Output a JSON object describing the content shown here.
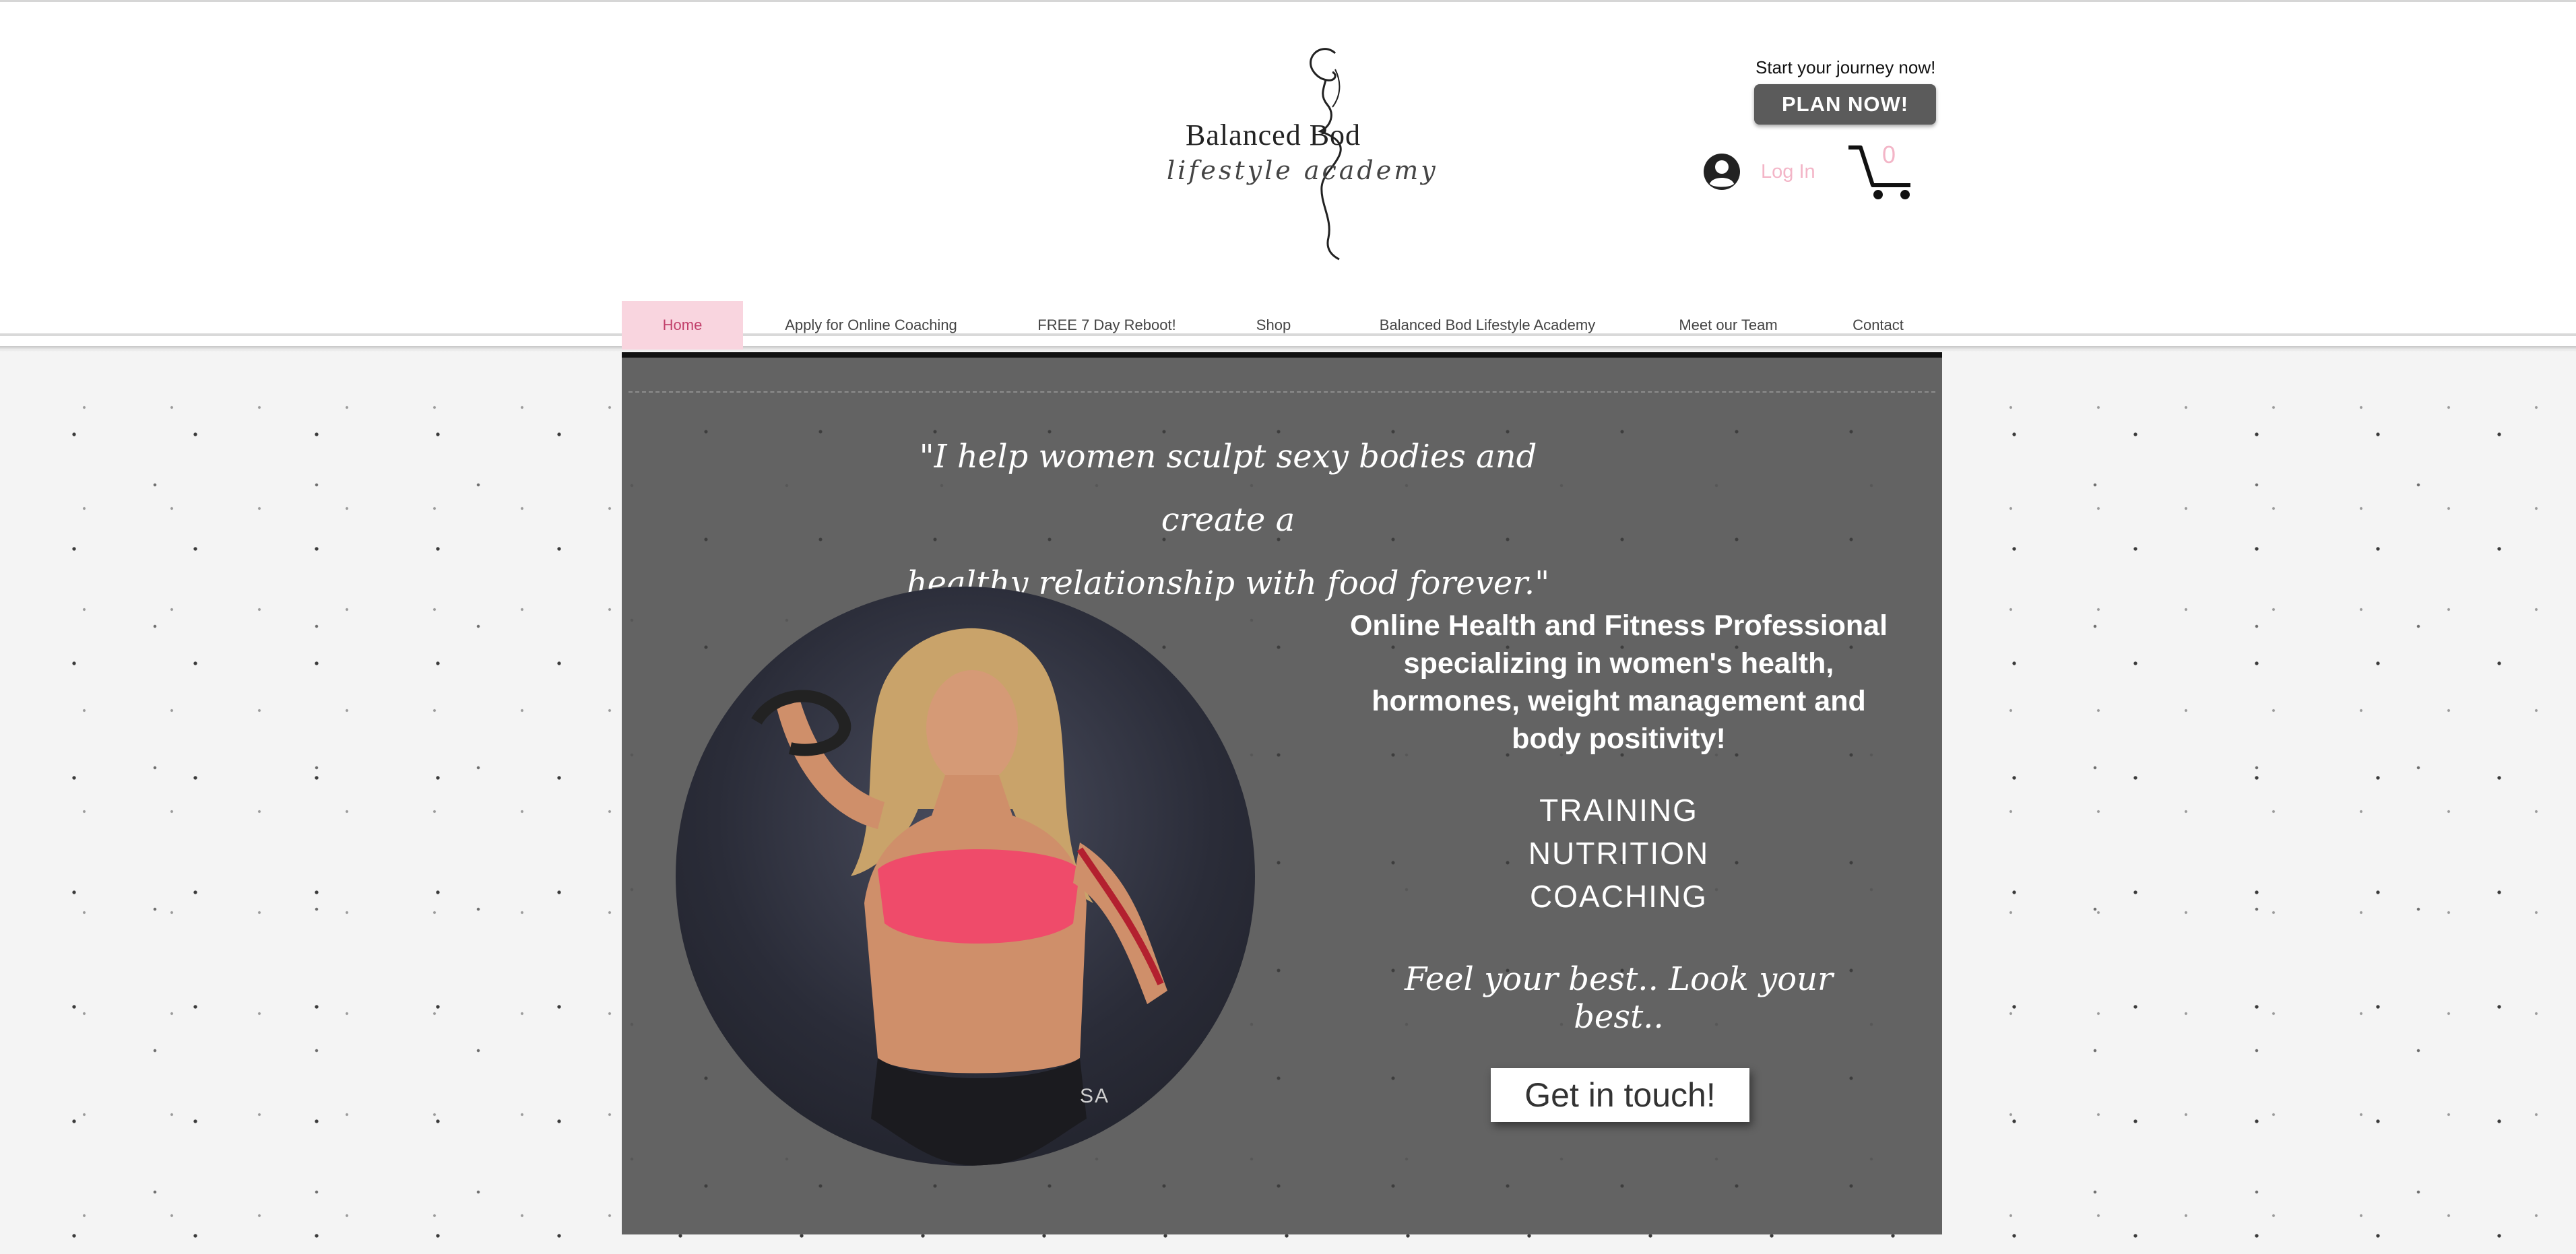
{
  "brand": {
    "logo_title": "Balanced Bod",
    "logo_subtitle": "lifestyle academy"
  },
  "header": {
    "journey_text": "Start your journey now!",
    "plan_button": "PLAN NOW!",
    "login_label": "Log In",
    "login_icon": "user-avatar-icon",
    "cart_icon": "shopping-cart-icon",
    "cart_count": "0"
  },
  "nav": {
    "items": [
      {
        "label": "Home",
        "active": true
      },
      {
        "label": "Apply for Online Coaching",
        "active": false
      },
      {
        "label": "FREE 7 Day Reboot!",
        "active": false
      },
      {
        "label": "Shop",
        "active": false
      },
      {
        "label": "Balanced Bod Lifestyle Academy",
        "active": false
      },
      {
        "label": "Meet our Team",
        "active": false
      },
      {
        "label": "Contact",
        "active": false
      }
    ]
  },
  "hero": {
    "quote_line1": "\"I help women sculpt sexy bodies and create a",
    "quote_line2": "healthy relationship with food forever.\"",
    "headline": "Online Health and Fitness Professional specializing in women's health, hormones, weight management and body positivity!",
    "services": [
      "TRAINING",
      "NUTRITION",
      "COACHING"
    ],
    "tagline": "Feel your best.. Look your best..",
    "cta_button": "Get in touch!",
    "photo_watermark": "SA"
  },
  "colors": {
    "accent_pink": "#f3b5c7",
    "nav_active_bg": "#f9d5df",
    "nav_active_text": "#c2406b",
    "hero_bg": "#636363",
    "button_dark": "#5b5b5b"
  }
}
